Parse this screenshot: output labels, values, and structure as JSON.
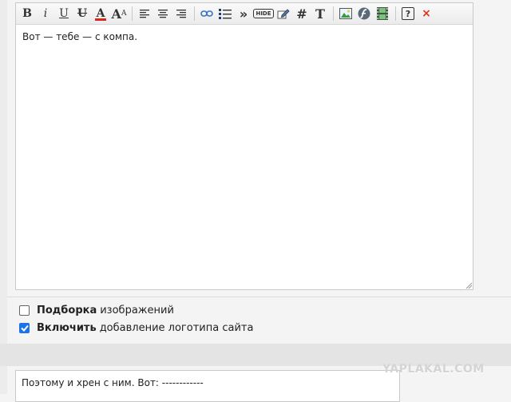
{
  "editor": {
    "content": "Вот — тебе — с компа."
  },
  "toolbar": {
    "bold": "B",
    "italic": "i",
    "underline": "U",
    "strike": "U",
    "color": "A",
    "size": "A",
    "size_sup": "A",
    "quote": "»",
    "hide": "HIDE",
    "hash": "#",
    "font": "T",
    "help": "?",
    "close": "×"
  },
  "options": [
    {
      "bold": "Подборка",
      "text": "изображений",
      "checked": false
    },
    {
      "bold": "Включить",
      "text": "добавление логотипа сайта",
      "checked": true
    }
  ],
  "reply": {
    "content": "Поэтому и хрен с ним. Вот: ------------"
  },
  "watermark": "YAPLAKAL.COM",
  "colors": {
    "accent": "#1a73e8",
    "close": "#e0321e"
  }
}
